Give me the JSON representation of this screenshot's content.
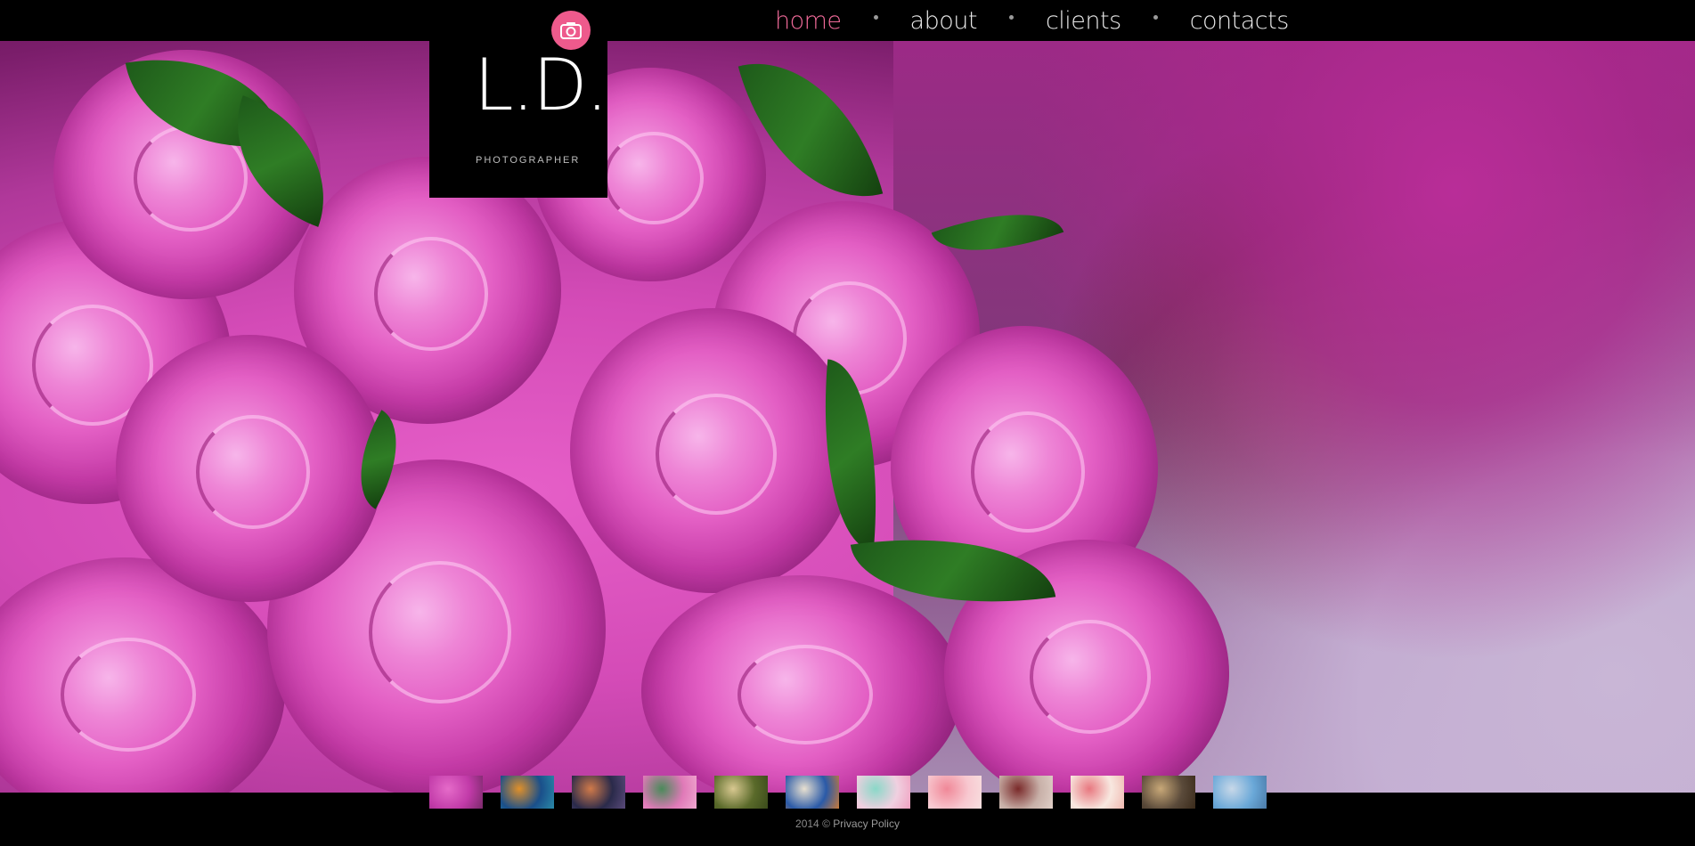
{
  "nav": {
    "items": [
      {
        "label": "home",
        "active": true
      },
      {
        "label": "about",
        "active": false
      },
      {
        "label": "clients",
        "active": false
      },
      {
        "label": "contacts",
        "active": false
      }
    ]
  },
  "logo": {
    "mark": "L.D.",
    "subtitle": "PHOTOGRAPHER",
    "badge_icon": "camera-icon",
    "badge_color": "#ee5a8c"
  },
  "colors": {
    "accent": "#f06a99",
    "nav_text": "#e8e8e8",
    "background": "#000000"
  },
  "thumbnails": [
    {
      "name": "pink-roses-thumb",
      "colors": [
        "#c13aa8",
        "#e56bc9",
        "#7a2a6a"
      ]
    },
    {
      "name": "coral-reef-thumb",
      "colors": [
        "#1a4f8a",
        "#e0902a",
        "#2a8aa8"
      ]
    },
    {
      "name": "lighthouse-sunset-thumb",
      "colors": [
        "#2a2a4a",
        "#d07a4a",
        "#5a4a7a"
      ]
    },
    {
      "name": "tulips-thumb",
      "colors": [
        "#e07ab8",
        "#4a8a5a",
        "#f0a8d0"
      ]
    },
    {
      "name": "sign-thumb",
      "colors": [
        "#5a6a2a",
        "#d8c890",
        "#3a4a1a"
      ]
    },
    {
      "name": "painted-eggs-thumb",
      "colors": [
        "#2a5aa8",
        "#e8e0d0",
        "#c87a3a"
      ]
    },
    {
      "name": "cupcake-thumb",
      "colors": [
        "#f0d0e0",
        "#8ad8c8",
        "#f0a0c0"
      ]
    },
    {
      "name": "pink-cake-thumb",
      "colors": [
        "#f8c8d0",
        "#f08898",
        "#f8e0e0"
      ]
    },
    {
      "name": "tea-spices-thumb",
      "colors": [
        "#c8b0a8",
        "#7a2a2a",
        "#e0d0c8"
      ]
    },
    {
      "name": "macaron-thumb",
      "colors": [
        "#f8e8e0",
        "#e87880",
        "#f0b8b0"
      ]
    },
    {
      "name": "rustic-wood-thumb",
      "colors": [
        "#5a4a3a",
        "#c8a878",
        "#3a2a1a"
      ]
    },
    {
      "name": "beach-thumb",
      "colors": [
        "#6aa8d8",
        "#c8d8e8",
        "#4a7aa8"
      ]
    }
  ],
  "footer": {
    "year": "2014",
    "copyright": "©",
    "privacy_label": "Privacy Policy"
  }
}
